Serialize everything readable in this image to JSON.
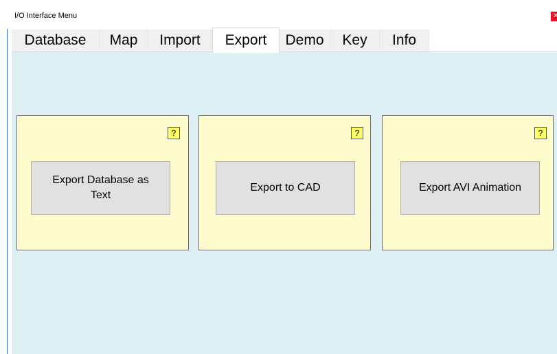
{
  "window": {
    "title": "I/O Interface Menu",
    "close_glyph": "✕"
  },
  "tabs": [
    {
      "label": "Database",
      "active": false
    },
    {
      "label": "Map",
      "active": false
    },
    {
      "label": "Import",
      "active": false
    },
    {
      "label": "Export",
      "active": true
    },
    {
      "label": "Demo",
      "active": false
    },
    {
      "label": "Key",
      "active": false
    },
    {
      "label": "Info",
      "active": false
    }
  ],
  "panels": [
    {
      "help_label": "?",
      "button_label": "Export Database as Text"
    },
    {
      "help_label": "?",
      "button_label": "Export to CAD"
    },
    {
      "help_label": "?",
      "button_label": "Export AVI Animation"
    }
  ],
  "colors": {
    "content_bg": "#dff0f5",
    "panel_bg": "#fefccd",
    "help_bg": "#ffff66",
    "button_bg": "#e1e1e1",
    "close_bg": "#e81123"
  }
}
